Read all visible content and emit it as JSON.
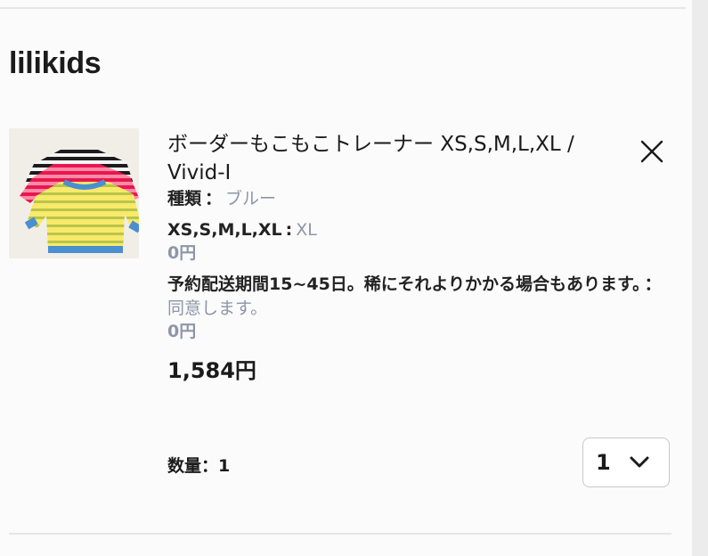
{
  "store": {
    "name": "lilikids"
  },
  "item": {
    "title": "ボーダーもこもこトレーナー XS,S,M,L,XL / Vivid-I",
    "options": [
      {
        "name": "種類",
        "separator": "：",
        "value": "ブルー"
      },
      {
        "name": "XS,S,M,L,XL",
        "separator": ":",
        "value": "XL",
        "price": "0円"
      },
      {
        "name": "予約配送期間15~45日。稀にそれよりかかる場合もあります。",
        "separator": "：",
        "value": "同意します。",
        "price": "0円"
      }
    ],
    "line_price": "1,584円",
    "quantity_label": "数量：1",
    "quantity_selected": "1",
    "image_icon": "product-photo-striped-sweatshirts",
    "remove_icon": "close-icon",
    "select_icon": "chevron-down-icon"
  },
  "colors": {
    "option_value": "#8d96a8",
    "text": "#1b1b1b",
    "divider": "#e6e6e6"
  }
}
